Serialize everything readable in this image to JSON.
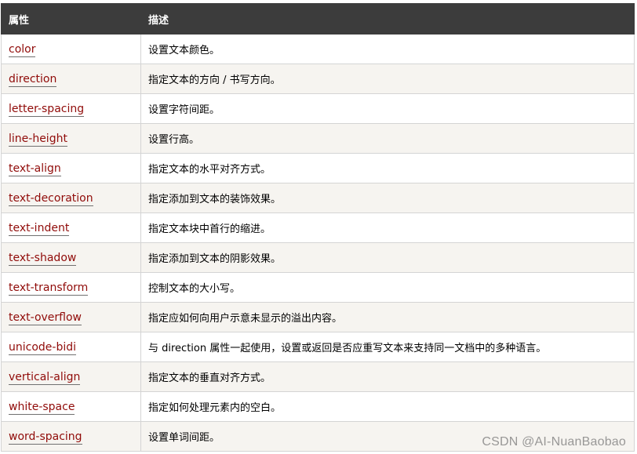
{
  "table": {
    "headers": {
      "property": "属性",
      "description": "描述"
    },
    "rows": [
      {
        "property": "color",
        "description": "设置文本颜色。"
      },
      {
        "property": "direction",
        "description": "指定文本的方向 / 书写方向。"
      },
      {
        "property": "letter-spacing",
        "description": "设置字符间距。"
      },
      {
        "property": "line-height",
        "description": "设置行高。"
      },
      {
        "property": "text-align",
        "description": "指定文本的水平对齐方式。"
      },
      {
        "property": "text-decoration",
        "description": "指定添加到文本的装饰效果。"
      },
      {
        "property": "text-indent",
        "description": "指定文本块中首行的缩进。"
      },
      {
        "property": "text-shadow",
        "description": "指定添加到文本的阴影效果。"
      },
      {
        "property": "text-transform",
        "description": "控制文本的大小写。"
      },
      {
        "property": "text-overflow",
        "description": "指定应如何向用户示意未显示的溢出内容。"
      },
      {
        "property": "unicode-bidi",
        "description": "与 direction 属性一起使用，设置或返回是否应重写文本来支持同一文档中的多种语言。"
      },
      {
        "property": "vertical-align",
        "description": "指定文本的垂直对齐方式。"
      },
      {
        "property": "white-space",
        "description": "指定如何处理元素内的空白。"
      },
      {
        "property": "word-spacing",
        "description": "设置单词间距。"
      }
    ]
  },
  "watermark": "CSDN @AI-NuanBaobao",
  "colors": {
    "header_bg": "#3c3c3c",
    "header_text": "#ffffff",
    "link": "#900b09",
    "alt_row_bg": "#f6f4f0",
    "border": "#d4d4d4"
  }
}
